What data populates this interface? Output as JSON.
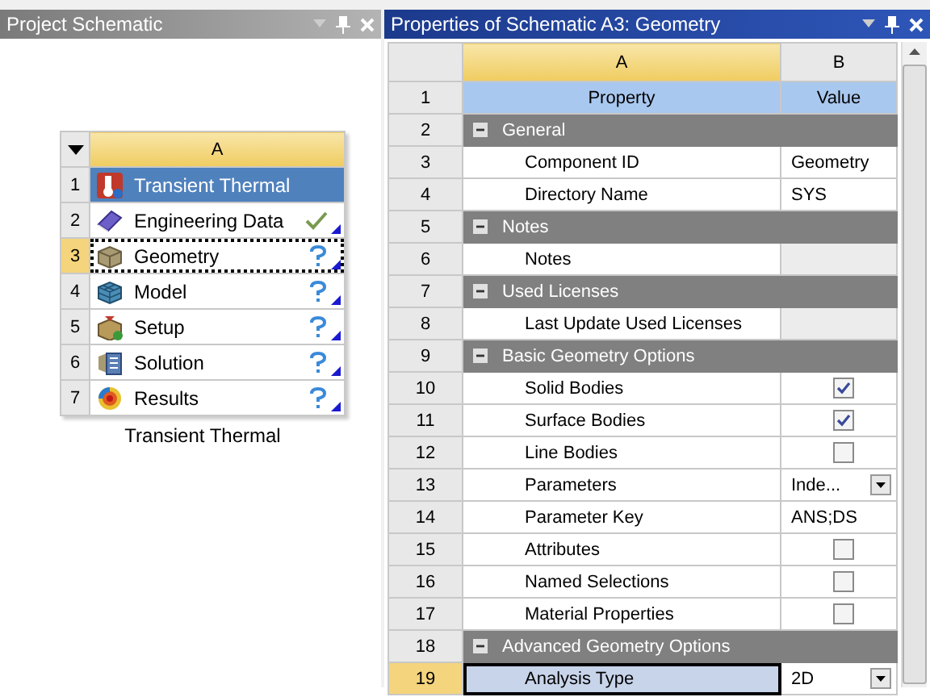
{
  "schematic_panel": {
    "title": "Project Schematic",
    "system": {
      "column": "A",
      "corner_selected": false,
      "rows": [
        {
          "number": "1",
          "label": "Transient Thermal",
          "kind": "title",
          "selected": false
        },
        {
          "number": "2",
          "label": "Engineering Data",
          "kind": "cell",
          "up_to_date": true,
          "selected": false
        },
        {
          "number": "3",
          "label": "Geometry",
          "kind": "cell",
          "up_to_date": false,
          "selected": true
        },
        {
          "number": "4",
          "label": "Model",
          "kind": "cell",
          "up_to_date": false,
          "selected": false
        },
        {
          "number": "5",
          "label": "Setup",
          "kind": "cell",
          "up_to_date": false,
          "selected": false
        },
        {
          "number": "6",
          "label": "Solution",
          "kind": "cell",
          "up_to_date": false,
          "selected": false
        },
        {
          "number": "7",
          "label": "Results",
          "kind": "cell",
          "up_to_date": false,
          "selected": false
        }
      ],
      "caption": "Transient Thermal"
    }
  },
  "properties_panel": {
    "title": "Properties of Schematic A3: Geometry",
    "columns": [
      "A",
      "B"
    ],
    "rows": [
      {
        "number": "1",
        "kind": "heading",
        "property": "Property",
        "value": "Value",
        "selected": false
      },
      {
        "number": "2",
        "kind": "group",
        "property": "General",
        "expanded": true,
        "selected": false
      },
      {
        "number": "3",
        "kind": "text",
        "property": "Component ID",
        "value": "Geometry",
        "selected": false
      },
      {
        "number": "4",
        "kind": "text",
        "property": "Directory Name",
        "value": "SYS",
        "selected": false
      },
      {
        "number": "5",
        "kind": "group",
        "property": "Notes",
        "expanded": true,
        "selected": false
      },
      {
        "number": "6",
        "kind": "text",
        "property": "Notes",
        "readonly": true,
        "selected": false
      },
      {
        "number": "7",
        "kind": "group",
        "property": "Used Licenses",
        "expanded": true,
        "selected": false
      },
      {
        "number": "8",
        "kind": "text",
        "property": "Last Update Used Licenses",
        "readonly": true,
        "selected": false
      },
      {
        "number": "9",
        "kind": "group",
        "property": "Basic Geometry Options",
        "expanded": true,
        "selected": false
      },
      {
        "number": "10",
        "kind": "check",
        "property": "Solid Bodies",
        "checked": true,
        "selected": false
      },
      {
        "number": "11",
        "kind": "check",
        "property": "Surface Bodies",
        "checked": true,
        "selected": false
      },
      {
        "number": "12",
        "kind": "check",
        "property": "Line Bodies",
        "checked": false,
        "selected": false
      },
      {
        "number": "13",
        "kind": "combo",
        "property": "Parameters",
        "value": "Inde...",
        "selected": false
      },
      {
        "number": "14",
        "kind": "text",
        "property": "Parameter Key",
        "value": "ANS;DS",
        "selected": false
      },
      {
        "number": "15",
        "kind": "check",
        "property": "Attributes",
        "checked": false,
        "selected": false
      },
      {
        "number": "16",
        "kind": "check",
        "property": "Named Selections",
        "checked": false,
        "selected": false
      },
      {
        "number": "17",
        "kind": "check",
        "property": "Material Properties",
        "checked": false,
        "selected": false
      },
      {
        "number": "18",
        "kind": "group",
        "property": "Advanced Geometry Options",
        "expanded": true,
        "selected": false
      },
      {
        "number": "19",
        "kind": "combo",
        "property": "Analysis Type",
        "value": "2D",
        "selected": true
      }
    ]
  }
}
